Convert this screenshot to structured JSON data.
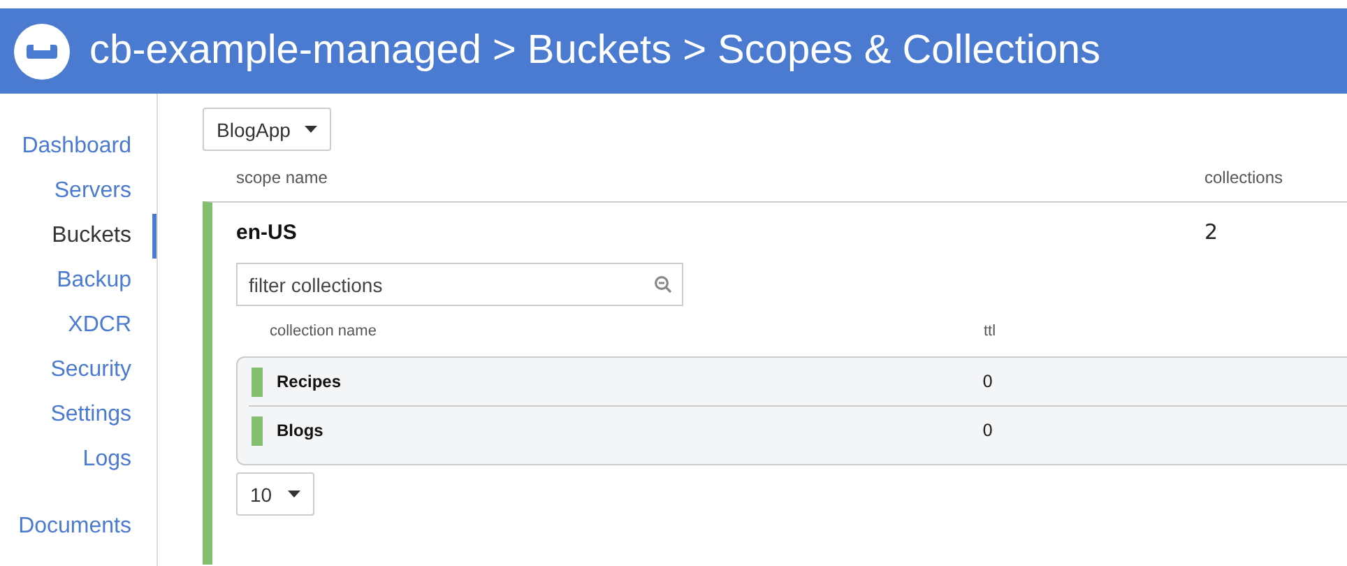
{
  "header": {
    "breadcrumbs": [
      "cb-example-managed",
      "Buckets",
      "Scopes & Collections"
    ],
    "separator": ">"
  },
  "sidebar": {
    "items": [
      {
        "label": "Dashboard",
        "selected": false
      },
      {
        "label": "Servers",
        "selected": false
      },
      {
        "label": "Buckets",
        "selected": true
      },
      {
        "label": "Backup",
        "selected": false
      },
      {
        "label": "XDCR",
        "selected": false
      },
      {
        "label": "Security",
        "selected": false
      },
      {
        "label": "Settings",
        "selected": false
      },
      {
        "label": "Logs",
        "selected": false
      }
    ],
    "items_2": [
      {
        "label": "Documents",
        "selected": false
      }
    ]
  },
  "bucket_select": {
    "value": "BlogApp"
  },
  "scopes": {
    "columns": [
      "scope name",
      "collections"
    ],
    "rows": [
      {
        "name": "en-US",
        "collections": "2",
        "expanded": true,
        "filter": {
          "placeholder": "filter collections"
        },
        "collection_columns": [
          "collection name",
          "ttl"
        ],
        "collection_rows": [
          {
            "name": "Recipes",
            "ttl": "0"
          },
          {
            "name": "Blogs",
            "ttl": "0"
          }
        ],
        "page_size": "10"
      }
    ]
  }
}
